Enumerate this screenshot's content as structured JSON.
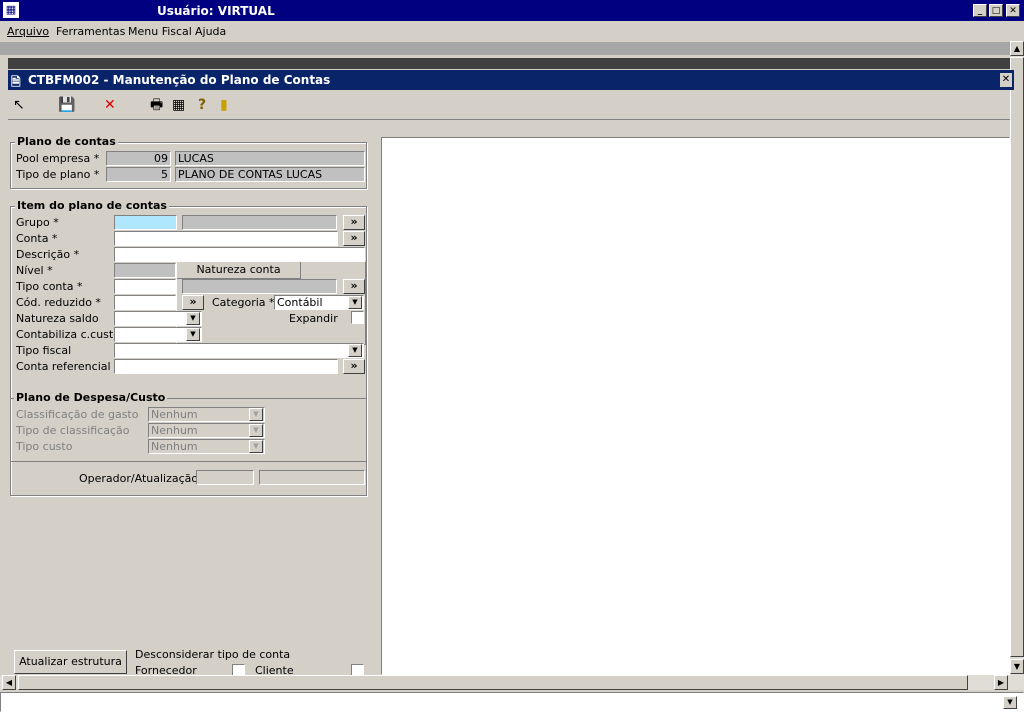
{
  "window": {
    "title": "Usuário: VIRTUAL",
    "controls": [
      "_",
      "□",
      "✕"
    ]
  },
  "menu": {
    "items": [
      "Arquivo",
      "Ferramentas",
      "Menu Fiscal",
      "Ajuda"
    ]
  },
  "child": {
    "title": "CTBFM002 - Manutenção do Plano de Contas",
    "close": "✕"
  },
  "toolbar": {
    "icons": [
      "pointer-icon",
      "save-icon",
      "delete-icon",
      "print-icon",
      "calendar-icon",
      "help-icon",
      "exit-icon"
    ]
  },
  "plano": {
    "title": "Plano de contas",
    "pool_label": "Pool empresa *",
    "pool_code": "09",
    "pool_name": "LUCAS",
    "tipo_label": "Tipo de plano *",
    "tipo_code": "5",
    "tipo_name": "PLANO DE CONTAS LUCAS"
  },
  "item": {
    "title": "Item do plano de contas",
    "grupo_label": "Grupo *",
    "grupo_value": "",
    "conta_label": "Conta *",
    "descricao_label": "Descrição *",
    "nivel_label": "Nível *",
    "natureza_conta_label": "Natureza conta",
    "tipo_conta_label": "Tipo conta *",
    "cod_reduzido_label": "Cód. reduzido *",
    "categoria_label": "Categoria *",
    "categoria_value": "Contábil",
    "natureza_saldo_label": "Natureza saldo",
    "expandir_label": "Expandir",
    "contabiliza_label": "Contabiliza c.custo",
    "tipo_fiscal_label": "Tipo fiscal",
    "conta_ref_label": "Conta referencial",
    "more_button": "»"
  },
  "despesa": {
    "title": "Plano de Despesa/Custo",
    "classificacao_label": "Classificação de gasto",
    "classificacao_value": "Nenhum",
    "tipo_class_label": "Tipo de classificação",
    "tipo_class_value": "Nenhum",
    "tipo_custo_label": "Tipo custo",
    "tipo_custo_value": "Nenhum"
  },
  "operador": {
    "label": "Operador/Atualização"
  },
  "footer": {
    "atualizar_button": "Atualizar estrutura",
    "desconsiderar_label": "Desconsiderar tipo de conta",
    "fornecedor_label": "Fornecedor",
    "cliente_label": "Cliente"
  }
}
